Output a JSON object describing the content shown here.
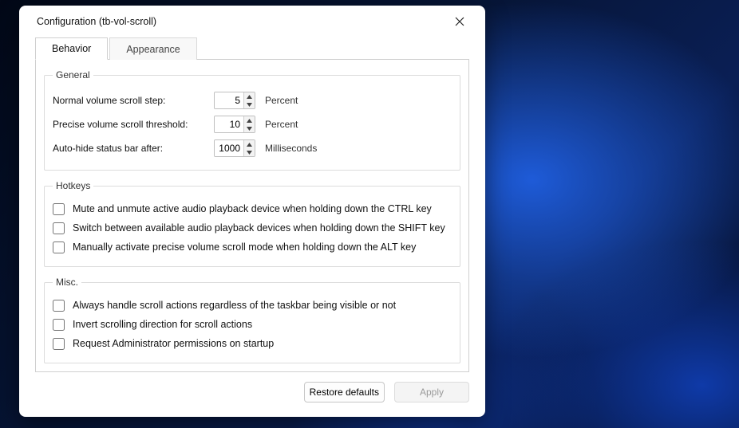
{
  "window": {
    "title": "Configuration (tb-vol-scroll)"
  },
  "tabs": {
    "behavior": "Behavior",
    "appearance": "Appearance",
    "active": "behavior"
  },
  "groups": {
    "general": {
      "legend": "General",
      "normal_step_label": "Normal volume scroll step:",
      "normal_step_value": "5",
      "normal_step_unit": "Percent",
      "precise_threshold_label": "Precise volume scroll threshold:",
      "precise_threshold_value": "10",
      "precise_threshold_unit": "Percent",
      "autohide_label": "Auto-hide status bar after:",
      "autohide_value": "1000",
      "autohide_unit": "Milliseconds"
    },
    "hotkeys": {
      "legend": "Hotkeys",
      "mute_ctrl": "Mute and unmute active audio playback device when holding down the CTRL key",
      "switch_shift": "Switch between available audio playback devices when holding down the SHIFT key",
      "precise_alt": "Manually activate precise volume scroll mode when holding down the ALT key"
    },
    "misc": {
      "legend": "Misc.",
      "always_handle": "Always handle scroll actions regardless of the taskbar being visible or not",
      "invert": "Invert scrolling direction for scroll actions",
      "admin": "Request Administrator permissions on startup"
    }
  },
  "footer": {
    "restore": "Restore defaults",
    "apply": "Apply"
  }
}
